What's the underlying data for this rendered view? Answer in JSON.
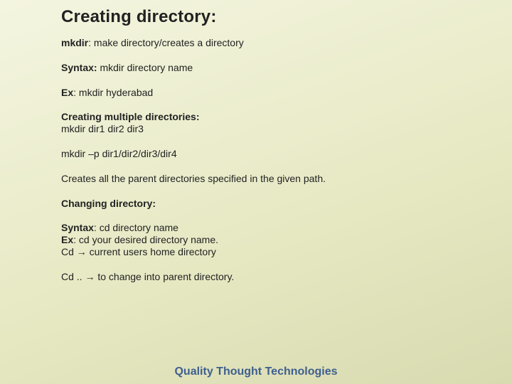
{
  "title": "Creating directory:",
  "lines": {
    "mkdir_label": "mkdir",
    "mkdir_desc": ": make directory/creates a directory",
    "syntax_label": "Syntax:",
    "syntax_val": " mkdir directory name",
    "ex_label": "Ex",
    "ex_val": ": mkdir hyderabad",
    "multi_label": "Creating multiple directories:",
    "multi_cmd": "mkdir dir1 dir2 dir3",
    "p_cmd": "mkdir –p dir1/dir2/dir3/dir4",
    "parent_note": "Creates all the parent directories specified in the given path.",
    "cd_header": "Changing directory:",
    "cd_syntax_label": "Syntax",
    "cd_syntax_val": ": cd directory name",
    "cd_ex_label": "Ex",
    "cd_ex_val": ": cd your desired directory name.",
    "cd_home": "Cd → current users home directory",
    "cd_parent": "Cd .. → to change into parent directory."
  },
  "footer": "Quality Thought Technologies"
}
